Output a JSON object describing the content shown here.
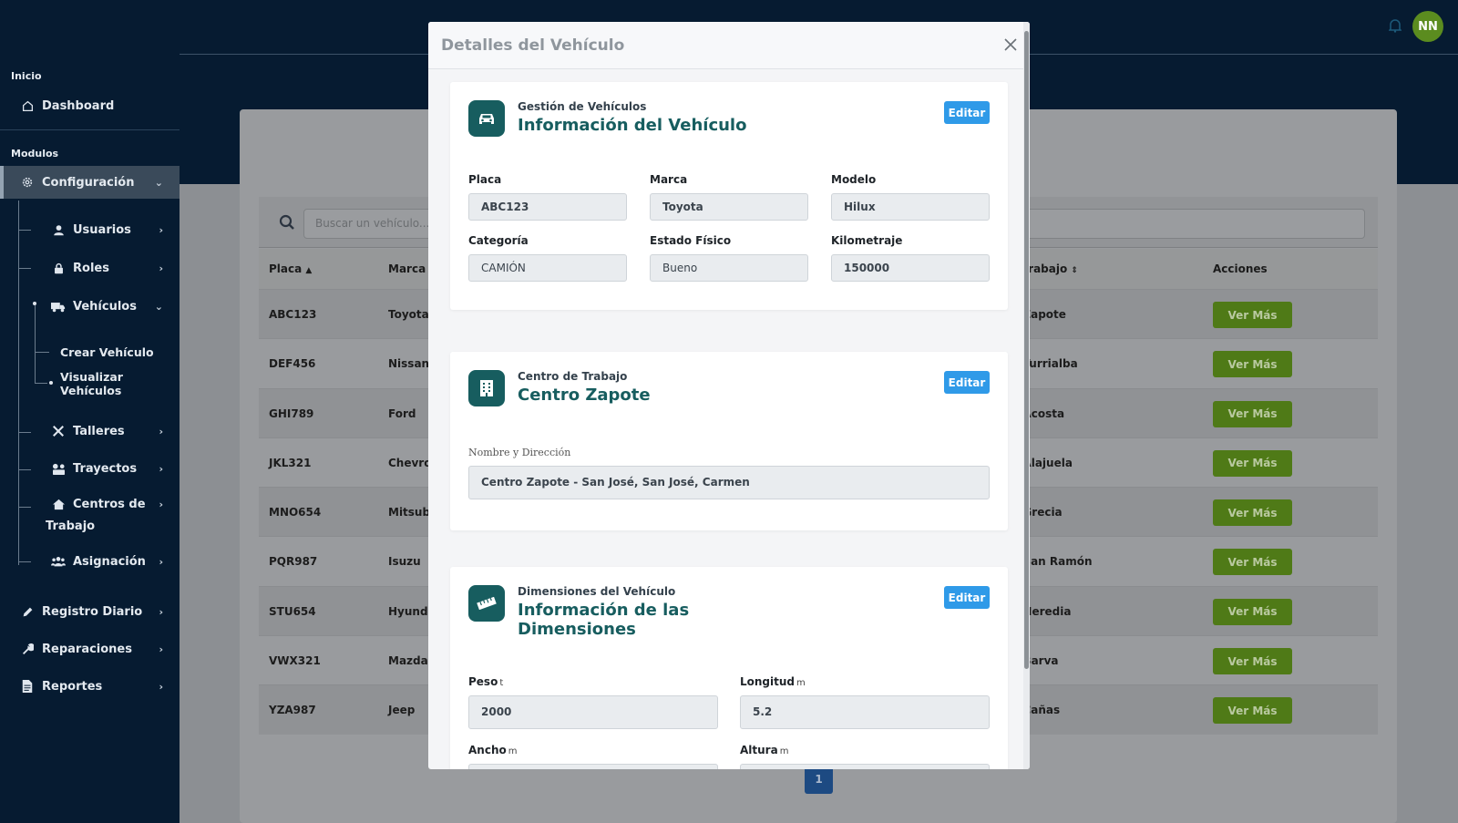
{
  "sidebar": {
    "section_inicio": "Inicio",
    "dashboard": "Dashboard",
    "section_modulos": "Modulos",
    "configuracion": "Configuración",
    "usuarios": "Usuarios",
    "roles": "Roles",
    "vehiculos": "Vehículos",
    "crear_vehiculo": "Crear Vehículo",
    "visualizar_vehiculos": "Visualizar Vehículos",
    "talleres": "Talleres",
    "trayectos": "Trayectos",
    "centros_line1": "Centros de",
    "centros_line2": "Trabajo",
    "asignacion": "Asignación",
    "registro_diario": "Registro Diario",
    "reparaciones": "Reparaciones",
    "reportes": "Reportes"
  },
  "topbar": {
    "avatar_initials": "NN"
  },
  "list": {
    "search_placeholder": "Buscar un vehículo...",
    "headers": {
      "placa": "Placa",
      "marca": "Marca",
      "centro": "o trabajo",
      "acciones": "Acciones"
    },
    "rows": [
      {
        "placa": "ABC123",
        "marca": "Toyota",
        "centro": "o Zapote",
        "action": "Ver Más"
      },
      {
        "placa": "DEF456",
        "marca": "Nissan",
        "centro": "o Turrialba",
        "action": "Ver Más"
      },
      {
        "placa": "GHI789",
        "marca": "Ford",
        "centro": "o Acosta",
        "action": "Ver Más"
      },
      {
        "placa": "JKL321",
        "marca": "Chevro",
        "centro": "o Alajuela",
        "action": "Ver Más"
      },
      {
        "placa": "MNO654",
        "marca": "Mitsub",
        "centro": "o Grecia",
        "action": "Ver Más"
      },
      {
        "placa": "PQR987",
        "marca": "Isuzu",
        "centro": "o San Ramón",
        "action": "Ver Más"
      },
      {
        "placa": "STU654",
        "marca": "Hyund",
        "centro": "o Heredia",
        "action": "Ver Más"
      },
      {
        "placa": "VWX321",
        "marca": "Mazda",
        "centro": "o Barva",
        "action": "Ver Más"
      },
      {
        "placa": "YZA987",
        "marca": "Jeep",
        "centro": "o Cañas",
        "action": "Ver Más"
      }
    ],
    "page": "1"
  },
  "modal": {
    "title": "Detalles del Vehículo",
    "vehicle": {
      "subtitle": "Gestión de Vehículos",
      "title": "Información del Vehículo",
      "edit": "Editar",
      "placa_label": "Placa",
      "placa": "ABC123",
      "marca_label": "Marca",
      "marca": "Toyota",
      "modelo_label": "Modelo",
      "modelo": "Hilux",
      "categoria_label": "Categoría",
      "categoria": "CAMIÓN",
      "estado_label": "Estado Físico",
      "estado": "Bueno",
      "km_label": "Kilometraje",
      "km": "150000"
    },
    "center": {
      "subtitle": "Centro de Trabajo",
      "title": "Centro Zapote",
      "edit": "Editar",
      "nombre_label": "Nombre y Dirección",
      "nombre": "Centro Zapote - San José, San José, Carmen"
    },
    "dimensions": {
      "subtitle": "Dimensiones del Vehículo",
      "title": "Información de las Dimensiones",
      "edit": "Editar",
      "peso_label": "Peso",
      "peso_unit": "t",
      "peso": "2000",
      "longitud_label": "Longitud",
      "longitud_unit": "m",
      "longitud": "5.2",
      "ancho_label": "Ancho",
      "ancho_unit": "m",
      "altura_label": "Altura",
      "altura_unit": "m"
    }
  }
}
